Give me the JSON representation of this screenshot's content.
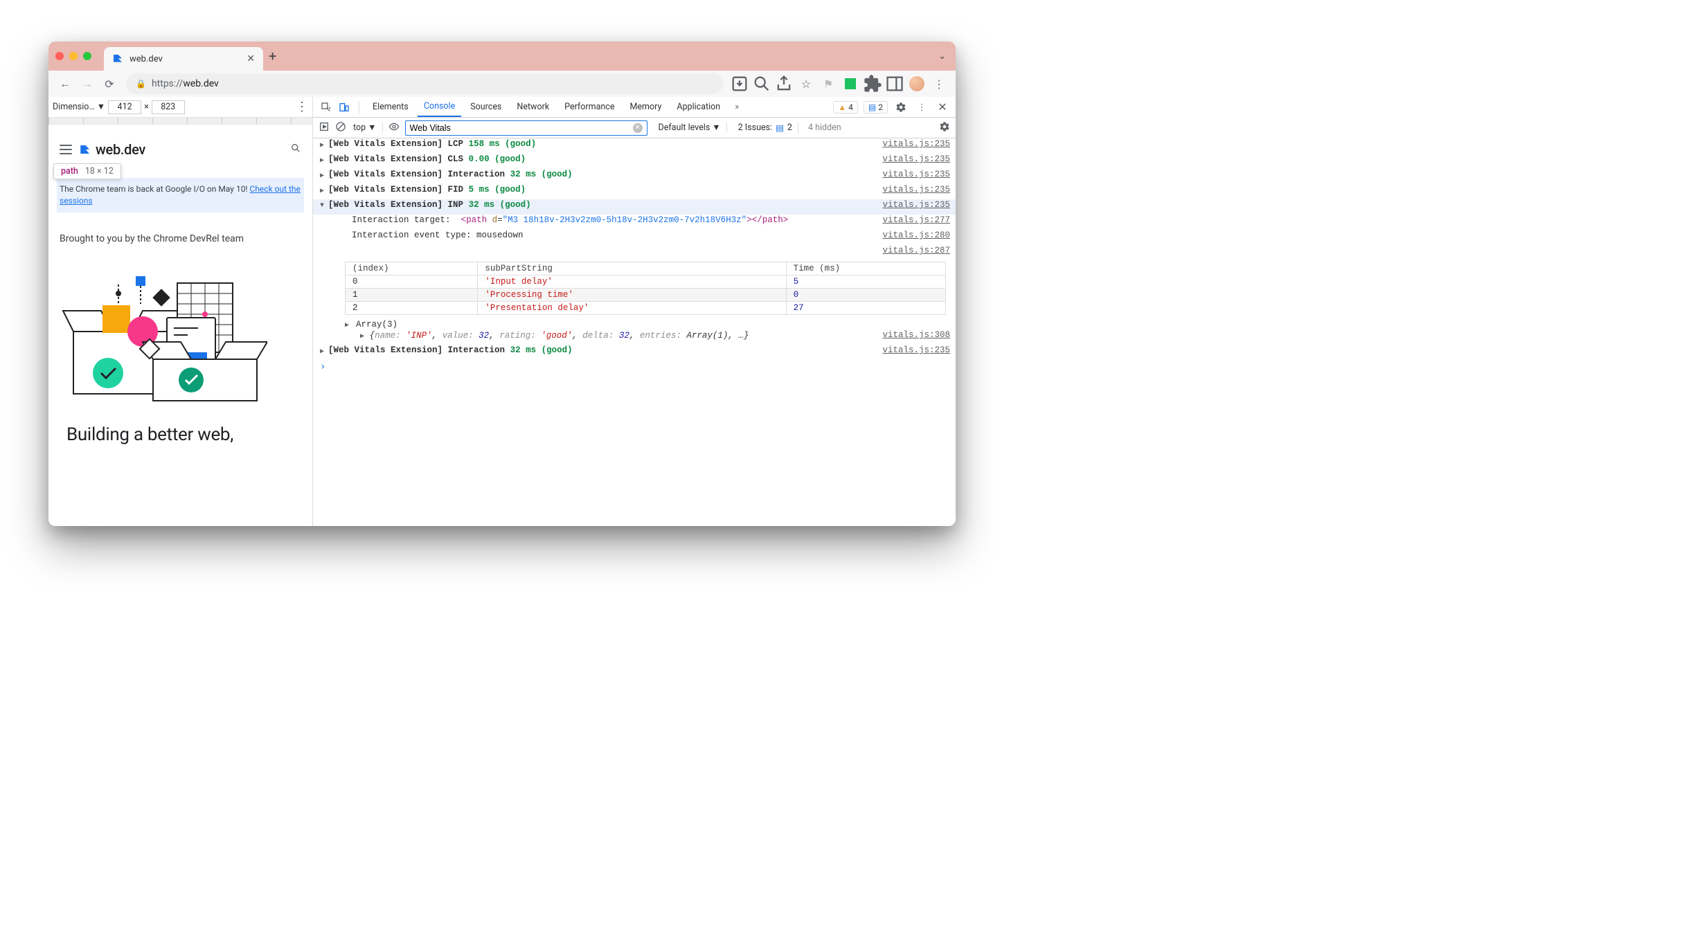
{
  "browser": {
    "tab_title": "web.dev",
    "url_protocol": "https://",
    "url_host": "web.dev"
  },
  "device_toolbar": {
    "label": "Dimensio…",
    "width": "412",
    "times": "×",
    "height": "823"
  },
  "tooltip": {
    "tag": "path",
    "dims": "18 × 12"
  },
  "site": {
    "logo_text": "web.dev",
    "banner_text": "The Chrome team is back at Google I/O on May 10! ",
    "banner_link": "Check out the sessions",
    "credit": "Brought to you by the Chrome DevRel team",
    "headline": "Building a better web,"
  },
  "devtools": {
    "tabs": [
      "Elements",
      "Console",
      "Sources",
      "Network",
      "Performance",
      "Memory",
      "Application"
    ],
    "active_tab": "Console",
    "warn_count": "4",
    "msg_count": "2",
    "filter_context": "top",
    "filter_value": "Web Vitals",
    "levels_label": "Default levels",
    "issues_label": "2 Issues:",
    "issues_count": "2",
    "hidden_label": "4 hidden"
  },
  "console": {
    "prefix": "[Web Vitals Extension]",
    "lines": [
      {
        "metric": "LCP",
        "value": "158 ms (good)",
        "src": "vitals.js:235"
      },
      {
        "metric": "CLS",
        "value": "0.00 (good)",
        "src": "vitals.js:235"
      },
      {
        "metric": "Interaction",
        "value": "32 ms (good)",
        "src": "vitals.js:235"
      },
      {
        "metric": "FID",
        "value": "5 ms (good)",
        "src": "vitals.js:235"
      }
    ],
    "inp": {
      "metric": "INP",
      "value": "32 ms (good)",
      "src": "vitals.js:235",
      "target_label": "Interaction target:",
      "target_src": "vitals.js:277",
      "target_tag": "path",
      "target_attr_name": "d",
      "target_attr_val": "\"M3 18h18v-2H3v2zm0-5h18v-2H3v2zm0-7v2h18V6H3z\"",
      "event_label": "Interaction event type:",
      "event_val": "mousedown",
      "event_src": "vitals.js:280",
      "perf_src": "vitals.js:287",
      "table": {
        "cols": [
          "(index)",
          "subPartString",
          "Time (ms)"
        ],
        "rows": [
          [
            "0",
            "'Input delay'",
            "5"
          ],
          [
            "1",
            "'Processing time'",
            "0"
          ],
          [
            "2",
            "'Presentation delay'",
            "27"
          ]
        ]
      },
      "array_label": "Array(3)",
      "obj": "{name: 'INP', value: 32, rating: 'good', delta: 32, entries: Array(1), …}",
      "obj_src": "vitals.js:308"
    },
    "trailing": {
      "metric": "Interaction",
      "value": "32 ms (good)",
      "src": "vitals.js:235"
    }
  }
}
